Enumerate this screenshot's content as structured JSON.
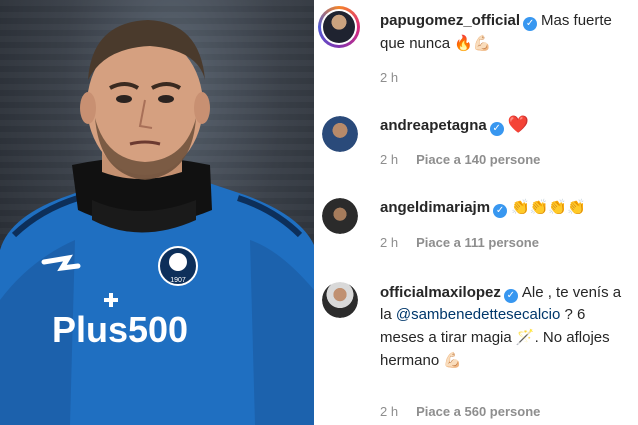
{
  "post": {
    "author": "papugomez_official",
    "caption": "Mas fuerte que nunca",
    "caption_emojis": "🔥💪🏻",
    "time": "2 h"
  },
  "comments": [
    {
      "user": "andreapetagna",
      "text": "",
      "emoji": "❤️",
      "time": "2 h",
      "likes": "Piace a 140 persone"
    },
    {
      "user": "angeldimariajm",
      "text": "",
      "emoji": "👏👏👏👏",
      "time": "2 h",
      "likes": "Piace a 111 persone"
    },
    {
      "user": "officialmaxilopez",
      "text_before": "Ale , te venís a la",
      "mention": "@sambenedettesecalcio",
      "text_after": "? 6 meses a tirar magia",
      "text_end": ". No aflojes hermano",
      "emoji_mid": "🪄",
      "emoji": "💪🏻",
      "time": "2 h",
      "likes": "Piace a 560 persone"
    }
  ],
  "photo": {
    "shirt_sponsor": "Plus500",
    "shirt_brand": "joma",
    "badge_year": "1907"
  },
  "colors": {
    "verified": "#3897f0",
    "mention": "#00376b",
    "meta": "#8e8e8e",
    "shirt": "#1f6fc1"
  }
}
